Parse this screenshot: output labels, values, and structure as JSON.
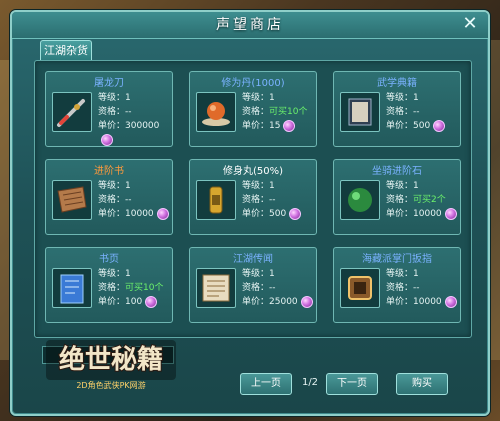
{
  "window": {
    "title": "声望商店",
    "close_label": "✕"
  },
  "tab": {
    "label": "江湖杂货"
  },
  "labels": {
    "level": "等级：",
    "qualification": "资格：",
    "price": "单价："
  },
  "items": [
    {
      "name": "屠龙刀",
      "level": "1",
      "qualification": "--",
      "price": "300000",
      "name_color": "#7ab2ff",
      "qual_color": "#e6f4f3",
      "icon": "sword-icon"
    },
    {
      "name": "修为丹(1000)",
      "level": "1",
      "qualification": "可买10个",
      "price": "15",
      "name_color": "#7ab2ff",
      "qual_color": "#6bf06b",
      "icon": "orb-icon"
    },
    {
      "name": "武学典籍",
      "level": "1",
      "qualification": "--",
      "price": "500",
      "name_color": "#7ab2ff",
      "qual_color": "#e6f4f3",
      "icon": "book-icon"
    },
    {
      "name": "进阶书",
      "level": "1",
      "qualification": "--",
      "price": "10000",
      "name_color": "#ff9a3c",
      "qual_color": "#e6f4f3",
      "icon": "scroll-icon"
    },
    {
      "name": "修身丸(50%)",
      "level": "1",
      "qualification": "--",
      "price": "500",
      "name_color": "#ffffff",
      "qual_color": "#e6f4f3",
      "icon": "pill-icon"
    },
    {
      "name": "坐骑进阶石",
      "level": "1",
      "qualification": "可买2个",
      "price": "10000",
      "name_color": "#7ab2ff",
      "qual_color": "#6bf06b",
      "icon": "stone-icon"
    },
    {
      "name": "书页",
      "level": "1",
      "qualification": "可买10个",
      "price": "100",
      "name_color": "#7ab2ff",
      "qual_color": "#6bf06b",
      "icon": "page-icon"
    },
    {
      "name": "江湖传闻",
      "level": "1",
      "qualification": "--",
      "price": "25000",
      "name_color": "#7ab2ff",
      "qual_color": "#e6f4f3",
      "icon": "letter-icon"
    },
    {
      "name": "海藏派掌门扳指",
      "level": "1",
      "qualification": "--",
      "price": "10000",
      "name_color": "#7ab2ff",
      "qual_color": "#e6f4f3",
      "icon": "ring-icon"
    }
  ],
  "pagination": {
    "prev_label": "上一页",
    "page": "1/2",
    "next_label": "下一页"
  },
  "buy_label": "购买",
  "logo": {
    "title": "绝世秘籍",
    "subtitle": "2D角色武侠PK网游"
  }
}
